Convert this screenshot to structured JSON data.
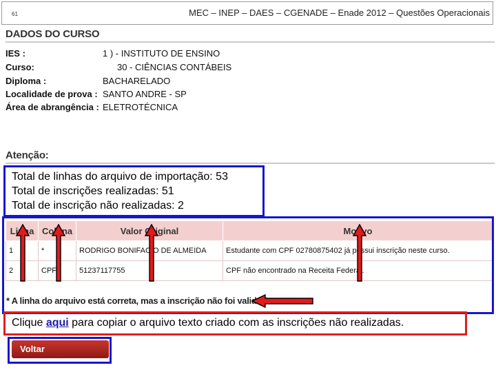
{
  "header": {
    "page_number": "61",
    "title": "MEC – INEP – DAES – CGENADE – Enade 2012 – Questões Operacionais"
  },
  "course": {
    "section_title": "DADOS DO CURSO",
    "rows": [
      {
        "label": "IES :",
        "value": "1 ) - INSTITUTO DE ENSINO"
      },
      {
        "label": "Curso:",
        "value": "30 - CIÊNCIAS CONTÁBEIS"
      },
      {
        "label": "Diploma :",
        "value": "BACHARELADO"
      },
      {
        "label": "Localidade de prova :",
        "value": "SANTO ANDRE - SP"
      },
      {
        "label": "Área de abrangência :",
        "value": "ELETROTÉCNICA"
      }
    ]
  },
  "attention": {
    "title": "Atenção:",
    "totals": [
      "Total de linhas do arquivo de importação: 53",
      "Total de inscrições realizadas: 51",
      "Total de inscrição não realizadas: 2"
    ]
  },
  "table": {
    "headers": [
      "Linha",
      "Coluna",
      "Valor Original",
      "Motivo"
    ],
    "rows": [
      {
        "linha": "1",
        "coluna": "*",
        "valor": "RODRIGO BONIFACIO DE ALMEIDA",
        "motivo": "Estudante com CPF 02780875402 já possui inscrição neste curso."
      },
      {
        "linha": "2",
        "coluna": "CPF",
        "valor": "51237117755",
        "motivo": "CPF não encontrado na Receita Federal."
      }
    ],
    "footnote": "* A linha do arquivo está correta, mas a inscrição não foi validada."
  },
  "copy_notice": {
    "before": "Clique ",
    "link": "aqui",
    "after": " para copiar o arquivo texto criado com as inscrições não realizadas."
  },
  "back_button": "Voltar",
  "colors": {
    "highlight_blue": "#1515d2",
    "highlight_red": "#dd1f1f",
    "table_header": "#f3d0cf",
    "button": "#b02820"
  }
}
